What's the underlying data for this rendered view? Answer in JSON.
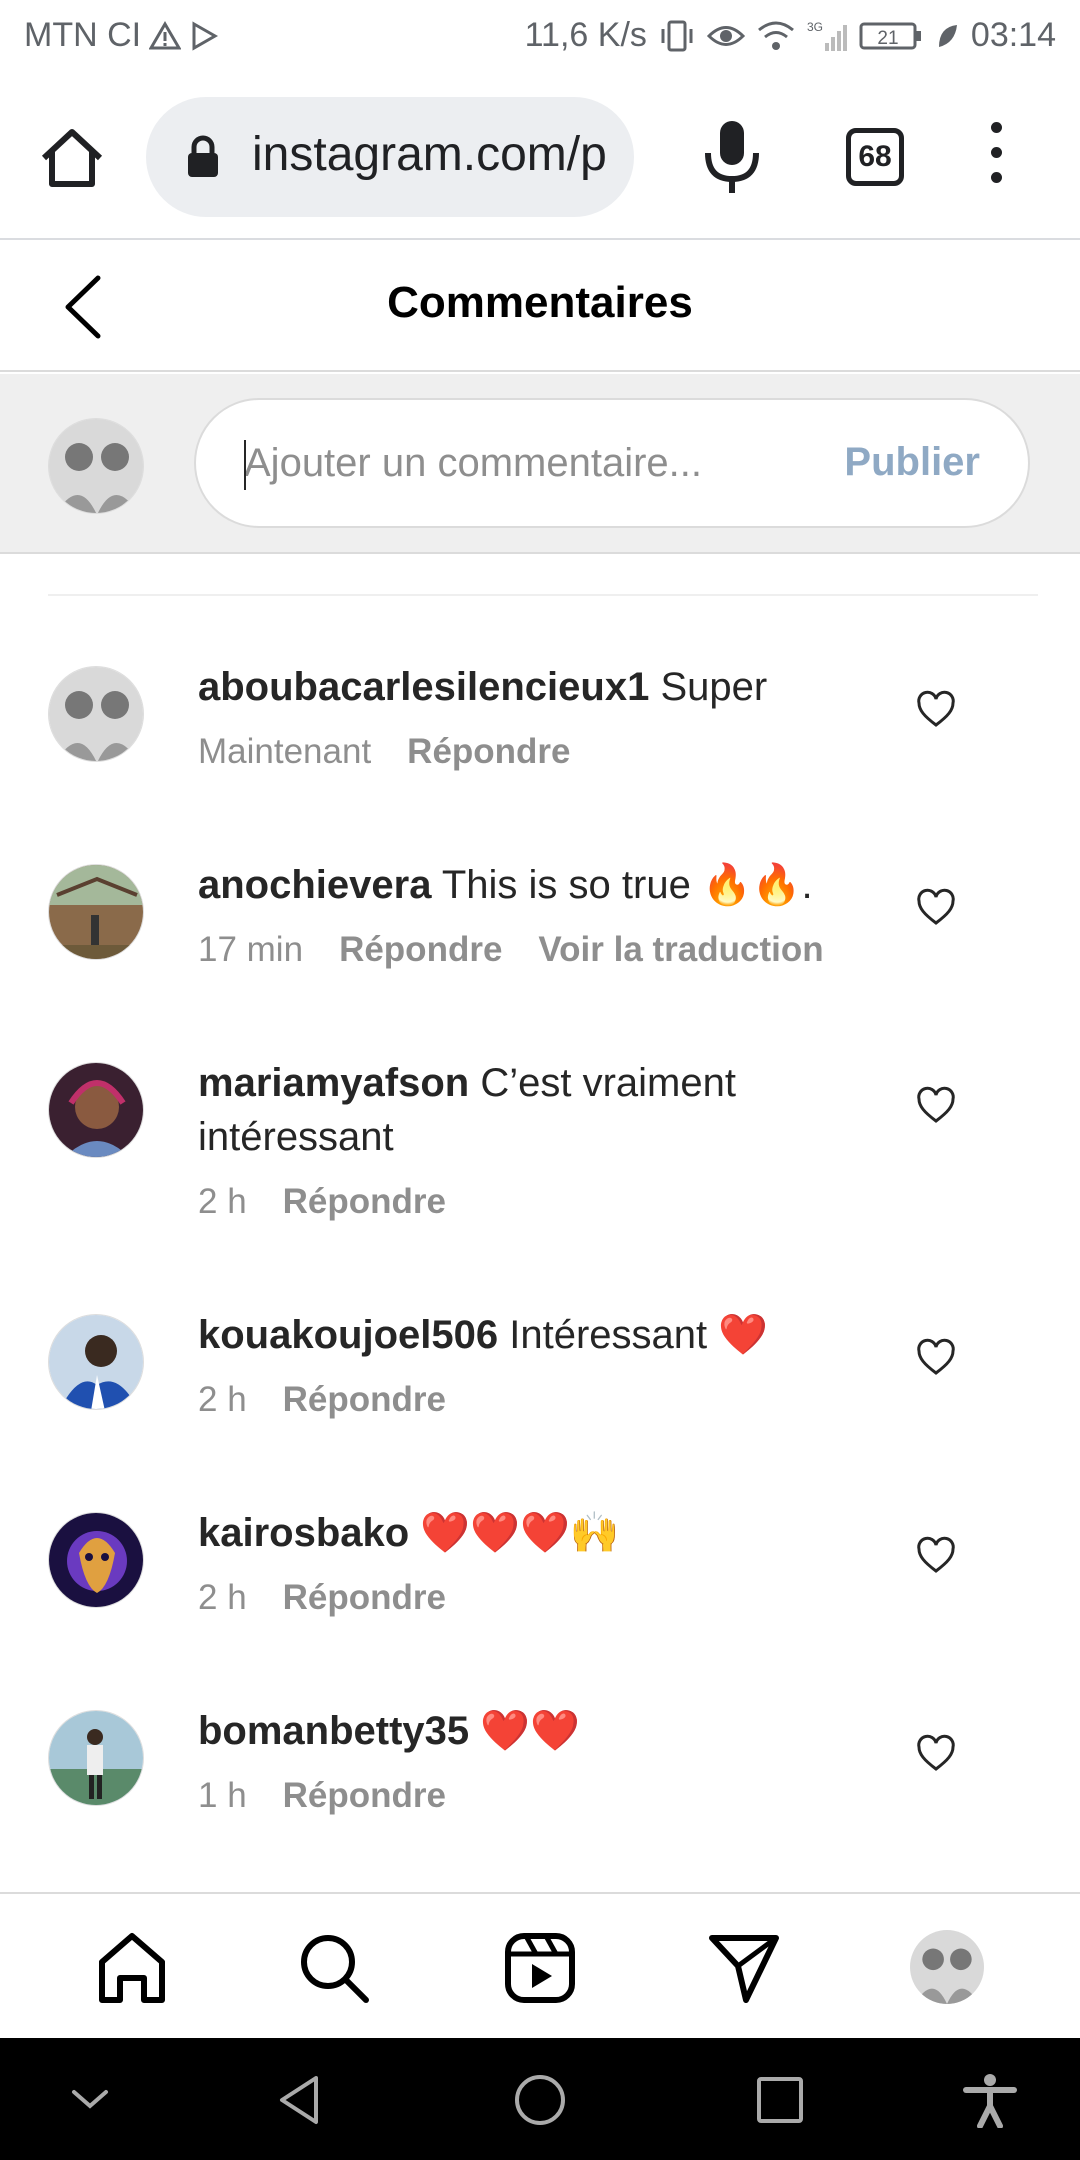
{
  "status_bar": {
    "carrier": "MTN CI",
    "net_speed": "11,6 K/s",
    "network": "3G",
    "battery": "21",
    "time": "03:14"
  },
  "browser": {
    "url": "instagram.com/p",
    "tab_count": "68"
  },
  "header": {
    "title": "Commentaires"
  },
  "composer": {
    "placeholder": "Ajouter un commentaire...",
    "value": "",
    "publish_label": "Publier"
  },
  "comments": [
    {
      "username": "aboubacarlesilencieux1",
      "text": "Super",
      "time": "Maintenant",
      "reply_label": "Répondre",
      "translate_label": ""
    },
    {
      "username": "anochievera",
      "text": "This is so true 🔥🔥.",
      "time": "17 min",
      "reply_label": "Répondre",
      "translate_label": "Voir la traduction"
    },
    {
      "username": "mariamyafson",
      "text": "C’est vraiment intéressant",
      "time": "2 h",
      "reply_label": "Répondre",
      "translate_label": ""
    },
    {
      "username": "kouakoujoel506",
      "text": "Intéressant ❤️",
      "time": "2 h",
      "reply_label": "Répondre",
      "translate_label": ""
    },
    {
      "username": "kairosbako",
      "text": "❤️❤️❤️🙌",
      "time": "2 h",
      "reply_label": "Répondre",
      "translate_label": ""
    },
    {
      "username": "bomanbetty35",
      "text": "❤️❤️",
      "time": "1 h",
      "reply_label": "Répondre",
      "translate_label": ""
    }
  ],
  "icons": {
    "status": [
      "warning-icon",
      "play-store-icon",
      "vibrate-icon",
      "eye-icon",
      "wifi-icon",
      "signal-icon",
      "battery-icon",
      "leaf-icon"
    ],
    "browser": [
      "home-icon",
      "lock-icon",
      "mic-icon",
      "tabs-icon",
      "menu-icon"
    ],
    "nav": [
      "home-icon",
      "search-icon",
      "reels-icon",
      "direct-icon",
      "profile-avatar"
    ],
    "system_nav": [
      "chevron-down-icon",
      "back-icon",
      "home-circle-icon",
      "recents-icon",
      "accessibility-icon"
    ]
  },
  "colors": {
    "publish_disabled": "#8fa9c4",
    "muted_text": "#8e8e8e",
    "composer_bg": "#efefef"
  }
}
